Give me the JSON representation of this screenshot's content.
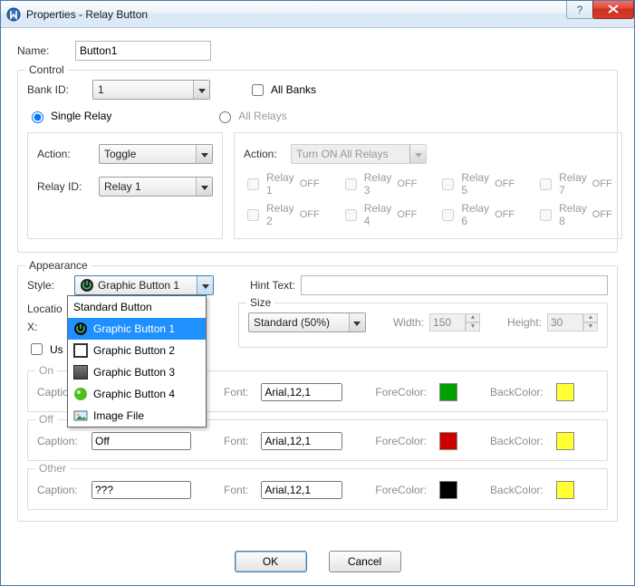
{
  "window": {
    "title": "Properties - Relay Button"
  },
  "name": {
    "label": "Name:",
    "value": "Button1"
  },
  "control": {
    "legend": "Control",
    "bank_id_label": "Bank ID:",
    "bank_id_value": "1",
    "all_banks_label": "All Banks",
    "single_relay_label": "Single Relay",
    "all_relays_label": "All Relays",
    "action_label": "Action:",
    "action_value": "Toggle",
    "relay_id_label": "Relay ID:",
    "relay_id_value": "Relay 1",
    "all_action_label": "Action:",
    "all_action_value": "Turn ON All Relays",
    "off_text": "OFF",
    "relays": [
      "Relay 1",
      "Relay 2",
      "Relay 3",
      "Relay 4",
      "Relay 5",
      "Relay 6",
      "Relay 7",
      "Relay 8"
    ]
  },
  "appearance": {
    "legend": "Appearance",
    "style_label": "Style:",
    "style_value": "Graphic Button 1",
    "style_options": [
      "Standard Button",
      "Graphic Button 1",
      "Graphic Button 2",
      "Graphic Button 3",
      "Graphic Button 4",
      "Image File"
    ],
    "hint_label": "Hint Text:",
    "hint_value": "",
    "location_label": "Locatio",
    "x_label": "X:",
    "use_label": "Us",
    "size_label": "Size",
    "size_value": "Standard  (50%)",
    "width_label": "Width:",
    "width_value": "150",
    "height_label": "Height:",
    "height_value": "30",
    "font_label": "Font:",
    "font_value": "Arial,12,1",
    "fore_label": "ForeColor:",
    "back_label": "BackColor:",
    "caption_label": "Caption:",
    "on": {
      "legend": "On",
      "caption": "",
      "fore": "#00a000",
      "back": "#ffff33"
    },
    "off": {
      "legend": "Off",
      "caption": "Off",
      "fore": "#cc0000",
      "back": "#ffff33"
    },
    "other": {
      "legend": "Other",
      "caption": "???",
      "fore": "#000000",
      "back": "#ffff33"
    }
  },
  "buttons": {
    "ok": "OK",
    "cancel": "Cancel"
  },
  "colors": {
    "accent": "#1e90ff"
  }
}
